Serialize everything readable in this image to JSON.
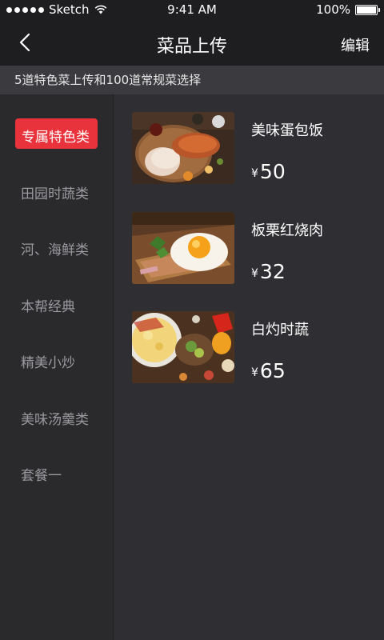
{
  "status_bar": {
    "carrier": "Sketch",
    "time": "9:41 AM",
    "battery": "100%"
  },
  "nav": {
    "title": "菜品上传",
    "edit_label": "编辑"
  },
  "info": {
    "text": "5道特色菜上传和100道常规菜选择"
  },
  "categories": [
    {
      "label": "专属特色类",
      "active": true
    },
    {
      "label": "田园时蔬类",
      "active": false
    },
    {
      "label": "河、海鲜类",
      "active": false
    },
    {
      "label": "本帮经典",
      "active": false
    },
    {
      "label": "精美小炒",
      "active": false
    },
    {
      "label": "美味汤羹类",
      "active": false
    },
    {
      "label": "套餐一",
      "active": false
    }
  ],
  "currency_symbol": "¥",
  "dishes": [
    {
      "name": "美味蛋包饭",
      "price": "50",
      "image": "roast-meat-photo"
    },
    {
      "name": "板栗红烧肉",
      "price": "32",
      "image": "fried-egg-toast-photo"
    },
    {
      "name": "白灼时蔬",
      "price": "65",
      "image": "vegetable-dishes-photo"
    }
  ],
  "colors": {
    "accent": "#e8333d",
    "background": "#2f2f33",
    "bar": "#1e1e21"
  }
}
